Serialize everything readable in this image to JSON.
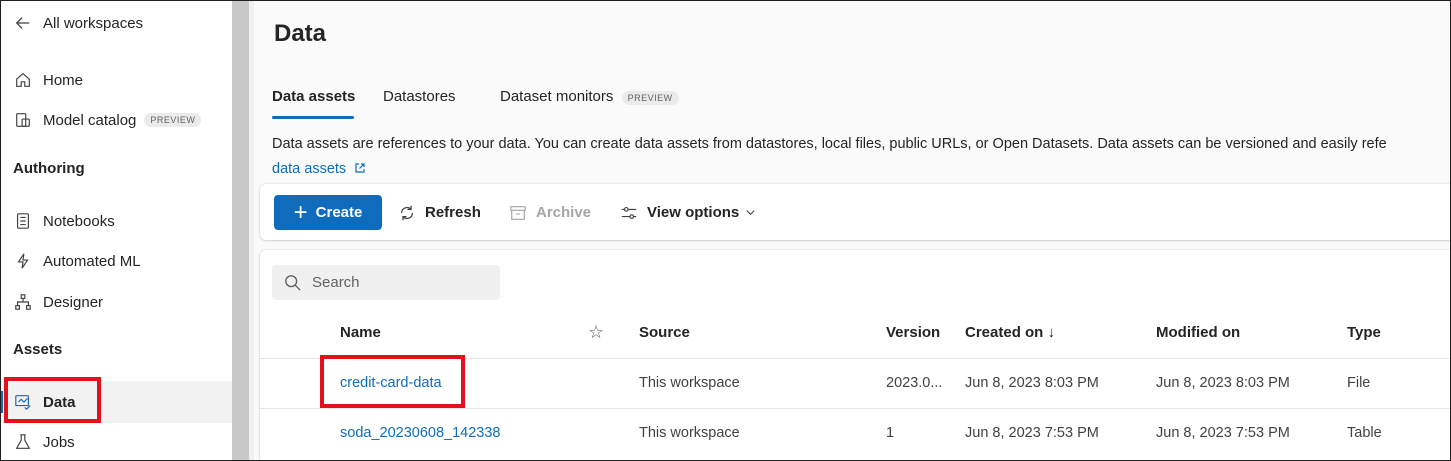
{
  "sidebar": {
    "back_label": "All workspaces",
    "home_label": "Home",
    "model_catalog_label": "Model catalog",
    "model_catalog_badge": "PREVIEW",
    "authoring_heading": "Authoring",
    "notebooks_label": "Notebooks",
    "automl_label": "Automated ML",
    "designer_label": "Designer",
    "assets_heading": "Assets",
    "data_label": "Data",
    "jobs_label": "Jobs"
  },
  "main": {
    "title": "Data",
    "tabs": [
      {
        "label": "Data assets",
        "active": true
      },
      {
        "label": "Datastores",
        "active": false
      },
      {
        "label": "Dataset monitors",
        "active": false,
        "badge": "PREVIEW"
      }
    ],
    "description": "Data assets are references to your data. You can create data assets from datastores, local files, public URLs, or Open Datasets. Data assets can be versioned and easily refe",
    "description_link": "data assets"
  },
  "toolbar": {
    "create_label": "Create",
    "refresh_label": "Refresh",
    "archive_label": "Archive",
    "view_options_label": "View options"
  },
  "table": {
    "search_placeholder": "Search",
    "headers": {
      "name": "Name",
      "source": "Source",
      "version": "Version",
      "created_on": "Created on ↓",
      "modified_on": "Modified on",
      "type": "Type"
    },
    "rows": [
      {
        "name": "credit-card-data",
        "source": "This workspace",
        "version": "2023.0...",
        "created_on": "Jun 8, 2023 8:03 PM",
        "modified_on": "Jun 8, 2023 8:03 PM",
        "type": "File"
      },
      {
        "name": "soda_20230608_142338",
        "source": "This workspace",
        "version": "1",
        "created_on": "Jun 8, 2023 7:53 PM",
        "modified_on": "Jun 8, 2023 7:53 PM",
        "type": "Table"
      }
    ]
  },
  "colors": {
    "accent": "#0f6cbd",
    "highlight": "#e3111c"
  }
}
